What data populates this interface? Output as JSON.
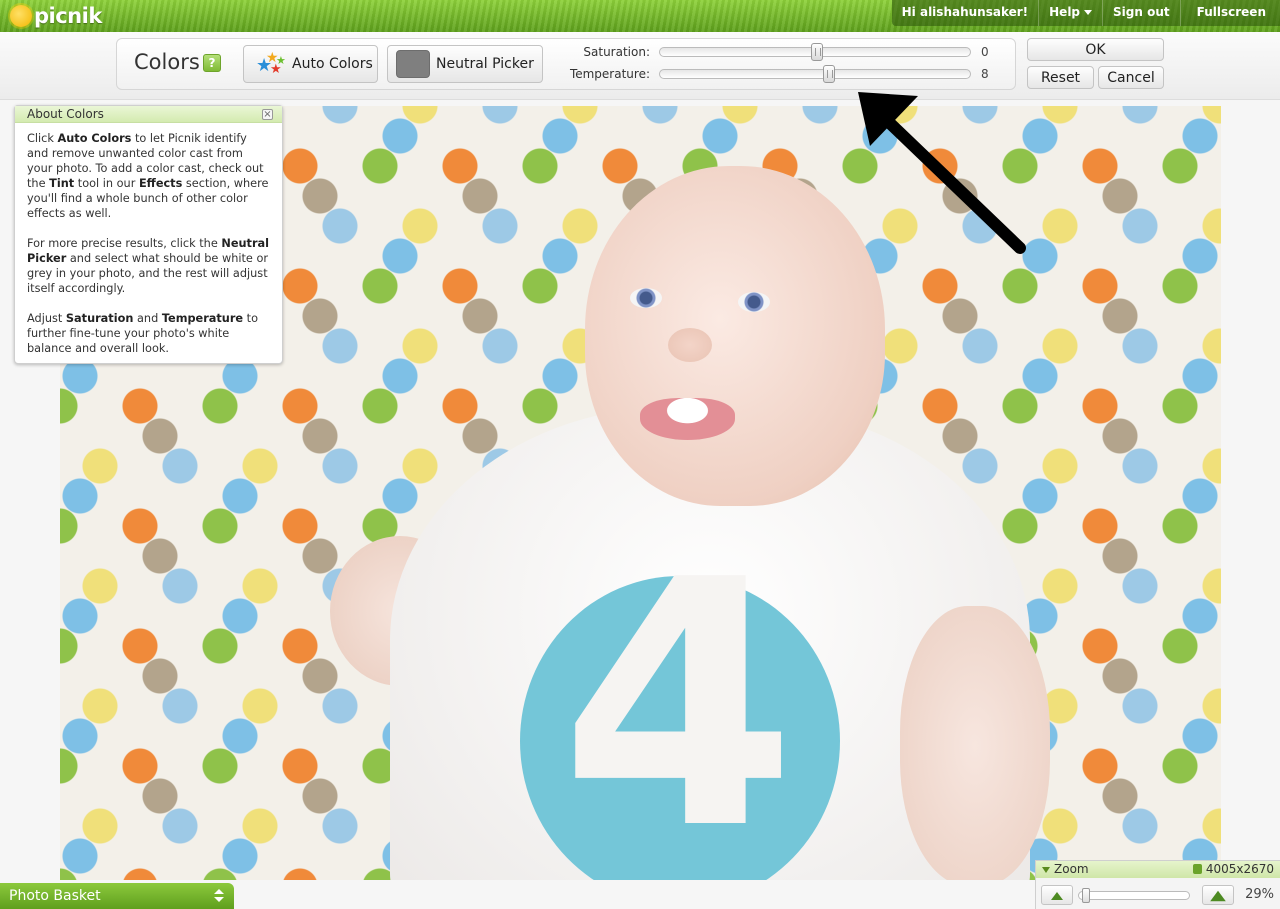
{
  "brand": {
    "name": "picnik"
  },
  "topnav": {
    "greeting": "Hi alishahunsaker!",
    "help": "Help",
    "signout": "Sign out",
    "fullscreen": "Fullscreen"
  },
  "toolbar": {
    "title": "Colors",
    "help_icon": "?",
    "auto_colors": "Auto Colors",
    "neutral_picker": "Neutral Picker",
    "saturation_label": "Saturation:",
    "saturation_value": "0",
    "temperature_label": "Temperature:",
    "temperature_value": "8",
    "ok": "OK",
    "reset": "Reset",
    "cancel": "Cancel",
    "swatch_color": "#7f7f7f"
  },
  "about": {
    "title": "About Colors",
    "p1": {
      "a": "Click ",
      "b": "Auto Colors",
      "c": " to let Picnik identify and remove unwanted color cast from your photo. To add a color cast, check out the ",
      "d": "Tint",
      "e": " tool in our ",
      "f": "Effects",
      "g": " section, where you'll find a whole bunch of other color effects as well."
    },
    "p2": {
      "a": "For more precise results, click the ",
      "b": "Neutral Picker",
      "c": " and select what should be white or grey in your photo, and the rest will adjust itself accordingly."
    },
    "p3": {
      "a": "Adjust ",
      "b": "Saturation",
      "c": " and ",
      "d": "Temperature",
      "e": " to further fine-tune your photo's white balance and overall look."
    }
  },
  "photo": {
    "shirt_number": "4"
  },
  "bottom": {
    "basket": "Photo Basket",
    "zoom_title": "Zoom",
    "image_size": "4005x2670",
    "zoom_percent": "29%"
  },
  "colors": {
    "accent": "#7fba35",
    "shirt_blue": "#74c6d8"
  }
}
